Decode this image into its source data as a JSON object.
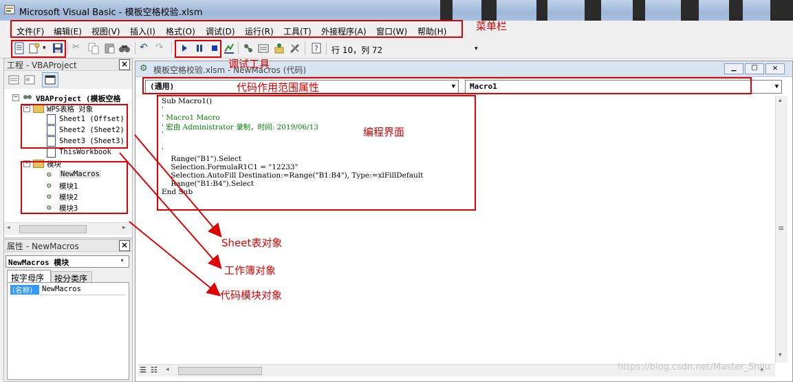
{
  "window": {
    "title": "Microsoft Visual Basic - 模板空格校验.xlsm"
  },
  "menu": [
    "文件(F)",
    "编辑(E)",
    "视图(V)",
    "插入(I)",
    "格式(O)",
    "调试(D)",
    "运行(R)",
    "工具(T)",
    "外接程序(A)",
    "窗口(W)",
    "帮助(H)"
  ],
  "toolbar": {
    "status": "行 10，列 72"
  },
  "project_panel": {
    "title": "工程 - VBAProject",
    "root": "VBAProject (模板空格",
    "group1": "WPS表格 对象",
    "sheets": [
      "Sheet1 (Offset)",
      "Sheet2 (Sheet2)",
      "Sheet3 (Sheet3)"
    ],
    "workbook": "ThisWorkbook",
    "group2": "模块",
    "modules": [
      "NewMacros",
      "模块1",
      "模块2",
      "模块3"
    ]
  },
  "properties_panel": {
    "title": "属性 - NewMacros",
    "object": "NewMacros 模块",
    "tabs": [
      "按字母序",
      "按分类序"
    ],
    "row_name": "(名称)",
    "row_value": "NewMacros"
  },
  "code_window": {
    "title": "模板空格校验.xlsm - NewMacros (代码)",
    "scope": "(通用)",
    "proc": "Macro1",
    "lines": [
      {
        "t": "Sub Macro1()",
        "c": "k"
      },
      {
        "t": "'",
        "c": "g"
      },
      {
        "t": "' Macro1 Macro",
        "c": "g"
      },
      {
        "t": "' 宏由 Administrator 录制，时间: 2019/06/13",
        "c": "g"
      },
      {
        "t": "'",
        "c": "g"
      },
      {
        "t": "",
        "c": "k"
      },
      {
        "t": "'",
        "c": "g"
      },
      {
        "t": "    Range(\"B1\").Select",
        "c": "k"
      },
      {
        "t": "    Selection.FormulaR1C1 = \"12233\"",
        "c": "k"
      },
      {
        "t": "    Selection.AutoFill Destination:=Range(\"B1:B4\"), Type:=xlFillDefault",
        "c": "k"
      },
      {
        "t": "    Range(\"B1:B4\").Select",
        "c": "k"
      },
      {
        "t": "End Sub",
        "c": "k"
      }
    ]
  },
  "annotations": {
    "menubar": "菜单栏",
    "debug": "调试工具",
    "scope": "代码作用范围属性",
    "editor": "编程界面",
    "sheet": "Sheet表对象",
    "workbook": "工作簿对象",
    "module": "代码模块对象"
  },
  "watermark": "https://blog.csdn.net/Master_Shiju",
  "colors": {
    "annotation_red": "#e00000",
    "comment_green": "#008000"
  }
}
